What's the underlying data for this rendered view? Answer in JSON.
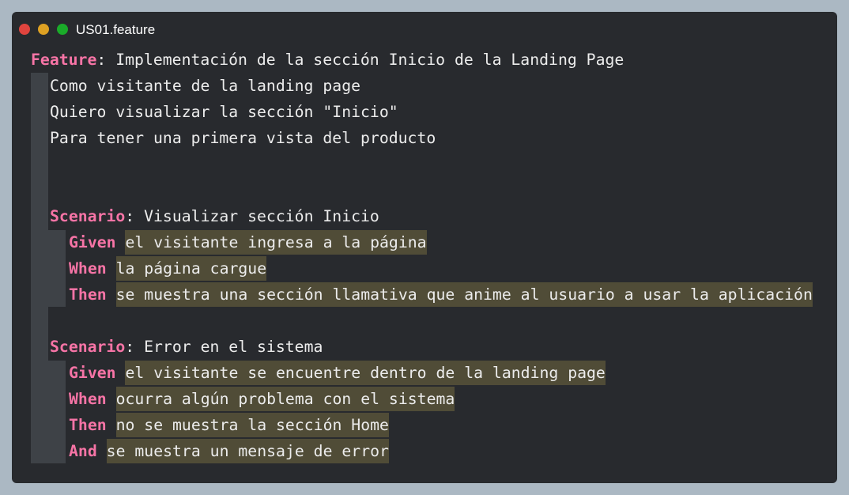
{
  "window": {
    "filename": "US01.feature",
    "controls": [
      "close",
      "minimize",
      "maximize"
    ]
  },
  "feature": {
    "keyword": "Feature",
    "title": "Implementación de la sección Inicio de la Landing Page",
    "description": [
      "Como visitante de la landing page",
      "Quiero visualizar la sección \"Inicio\"",
      "Para tener una primera vista del producto"
    ]
  },
  "scenarios": [
    {
      "keyword": "Scenario",
      "title": "Visualizar sección Inicio",
      "steps": [
        {
          "keyword": "Given",
          "text": "el visitante ingresa a la página"
        },
        {
          "keyword": "When",
          "text": "la página cargue"
        },
        {
          "keyword": "Then",
          "text": "se muestra una sección llamativa que anime al usuario a usar la aplicación"
        }
      ]
    },
    {
      "keyword": "Scenario",
      "title": "Error en el sistema",
      "steps": [
        {
          "keyword": "Given",
          "text": "el visitante se encuentre dentro de la landing page"
        },
        {
          "keyword": "When",
          "text": "ocurra algún problema con el sistema"
        },
        {
          "keyword": "Then",
          "text": "no se muestra la sección Home"
        },
        {
          "keyword": "And",
          "text": "se muestra un mensaje de error"
        }
      ]
    }
  ],
  "colors": {
    "page_background": "#abb8c3",
    "editor_background": "#282a2e",
    "keyword": "#f774a6",
    "text": "#ececec",
    "highlight": "#504c37",
    "indent_guide": "#3e4247"
  }
}
